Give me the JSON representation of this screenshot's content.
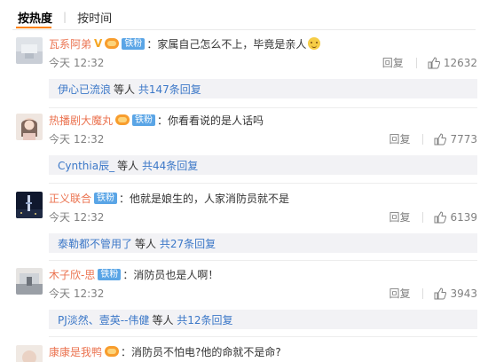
{
  "sort": {
    "hot": "按热度",
    "time": "按时间"
  },
  "comments": [
    {
      "user": "瓦系阿弟",
      "vbadge": "V",
      "fan": "铁粉",
      "text": "家属自己怎么不上，毕竟是亲人",
      "time": "今天 12:32",
      "reply": "回复",
      "likes": "12632",
      "sub": {
        "name": "伊心已流浪",
        "rest": "等人",
        "more": "共147条回复"
      }
    },
    {
      "user": "热播剧大魔丸",
      "fan": "铁粉",
      "text": "你看看说的是人话吗",
      "time": "今天 12:32",
      "reply": "回复",
      "likes": "7773",
      "sub": {
        "name": "Cynthia辰_",
        "rest": "等人",
        "more": "共44条回复"
      }
    },
    {
      "user": "正义联合",
      "fan": "铁粉",
      "text": "他就是娘生的，人家消防员就不是",
      "time": "今天 12:32",
      "reply": "回复",
      "likes": "6139",
      "sub": {
        "name": "泰勒都不管用了",
        "rest": "等人",
        "more": "共27条回复"
      }
    },
    {
      "user": "木子欣-思",
      "fan": "铁粉",
      "text": "消防员也是人啊！",
      "time": "今天 12:32",
      "reply": "回复",
      "likes": "3943",
      "sub": {
        "name": "PJ淡然、壹英--伟健",
        "rest": "等人",
        "more": "共12条回复"
      }
    },
    {
      "user": "康康是我鸭",
      "text": "消防员不怕电?他的命就不是命?"
    }
  ]
}
